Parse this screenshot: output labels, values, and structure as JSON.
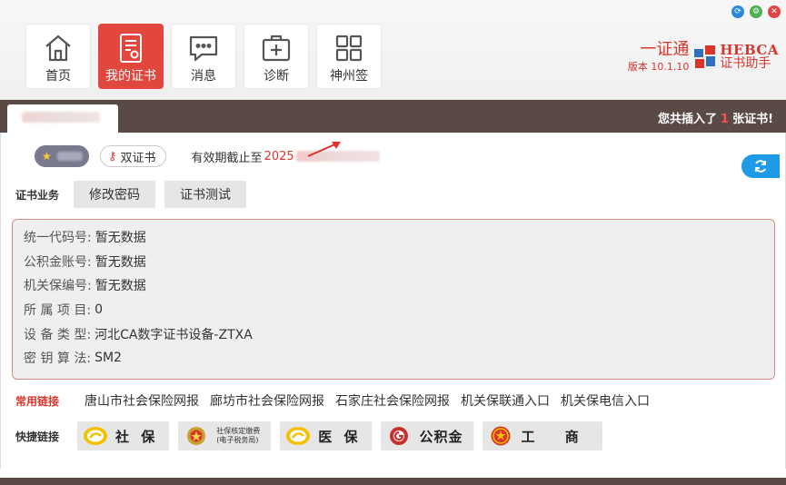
{
  "window": {
    "controls": [
      "refresh-icon",
      "settings-icon",
      "close-icon"
    ]
  },
  "nav": [
    {
      "label": "首页",
      "icon": "home-icon"
    },
    {
      "label": "我的证书",
      "icon": "certificate-icon",
      "active": true
    },
    {
      "label": "消息",
      "icon": "message-icon"
    },
    {
      "label": "诊断",
      "icon": "medical-kit-icon"
    },
    {
      "label": "神州签",
      "icon": "apps-grid-icon"
    }
  ],
  "brand": {
    "name": "一证通",
    "version": "版本 10.1.10",
    "logo_en": "HEBCA",
    "logo_cn": "证书助手"
  },
  "strip": {
    "notice_prefix": "您共插入了",
    "notice_count": "1",
    "notice_suffix": "张证书!"
  },
  "status": {
    "dual_cert": "双证书",
    "validity_label": "有效期截止至",
    "validity_year": "2025"
  },
  "business": {
    "label": "证书业务",
    "buttons": [
      "修改密码",
      "证书测试"
    ]
  },
  "info": [
    {
      "label": "统一代码号:",
      "value": "暂无数据"
    },
    {
      "label": "公积金账号:",
      "value": "暂无数据"
    },
    {
      "label": "机关保编号:",
      "value": "暂无数据"
    },
    {
      "label": "所 属 项 目:",
      "value": "0"
    },
    {
      "label": "设 备 类 型:",
      "value": "河北CA数字证书设备-ZTXA"
    },
    {
      "label": "密 钥 算 法:",
      "value": "SM2"
    }
  ],
  "common_links": {
    "label": "常用链接",
    "items": [
      "唐山市社会保险网报",
      "廊坊市社会保险网报",
      "石家庄社会保险网报",
      "机关保联通入口",
      "机关保电信入口"
    ]
  },
  "quick_links": {
    "label": "快捷链接",
    "items": [
      {
        "text": "社 保",
        "icon": "social-security-icon"
      },
      {
        "text": "社保核定缴费",
        "text2": "(电子税务局)",
        "icon": "tax-emblem-icon"
      },
      {
        "text": "医 保",
        "icon": "medical-insurance-icon"
      },
      {
        "text": "公积金",
        "icon": "housing-fund-icon"
      },
      {
        "text": "工 商",
        "icon": "national-emblem-icon"
      }
    ]
  },
  "colors": {
    "accent": "#e2473e",
    "strip": "#5a4a46",
    "blue": "#1e9be6"
  }
}
